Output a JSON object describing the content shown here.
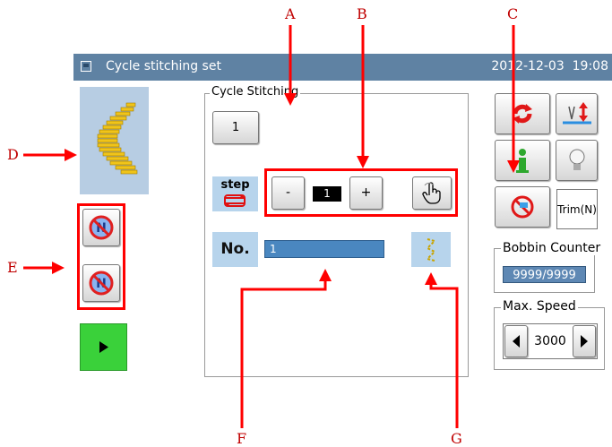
{
  "titlebar": {
    "title": "Cycle stitching set",
    "date": "2012-12-03",
    "time": "19:08"
  },
  "cycle": {
    "group_label": "Cycle Stitching",
    "number_button": "1",
    "step_icon_text": "step",
    "minus_label": "-",
    "step_value": "1",
    "plus_label": "+",
    "no_icon_text": "No.",
    "no_value": "1"
  },
  "right_panel": {
    "trim_label": "Trim(N)",
    "bobbin": {
      "label": "Bobbin Counter",
      "value": "9999/9999"
    },
    "speed": {
      "label": "Max. Speed",
      "value": "3000"
    }
  },
  "annotations": {
    "A": "A",
    "B": "B",
    "C": "C",
    "D": "D",
    "E": "E",
    "F": "F",
    "G": "G"
  },
  "colors": {
    "accent_red": "#ff0000",
    "titlebar": "#5f82a3",
    "icon_panel": "#b7cde3",
    "play_green": "#3ad13a"
  }
}
